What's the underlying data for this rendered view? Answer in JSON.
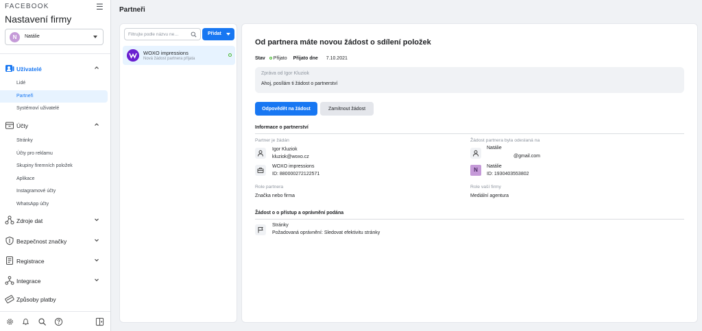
{
  "app": {
    "brand": "FACEBOOK",
    "title": "Nastavení firmy"
  },
  "account": {
    "initial": "N",
    "name": "Natálie"
  },
  "sidebar": {
    "sections": [
      {
        "label": "Uživatelé",
        "icon": "users-icon",
        "expanded": true,
        "items": [
          {
            "label": "Lidé"
          },
          {
            "label": "Partneři",
            "selected": true
          },
          {
            "label": "Systémoví uživatelé"
          }
        ]
      },
      {
        "label": "Účty",
        "icon": "accounts-icon",
        "expanded": true,
        "items": [
          {
            "label": "Stránky"
          },
          {
            "label": "Účty pro reklamu"
          },
          {
            "label": "Skupiny firemních položek"
          },
          {
            "label": "Aplikace"
          },
          {
            "label": "Instagramové účty"
          },
          {
            "label": "WhatsApp účty"
          }
        ]
      },
      {
        "label": "Zdroje dat",
        "icon": "data-sources-icon",
        "expanded": false
      },
      {
        "label": "Bezpečnost značky",
        "icon": "shield-icon",
        "expanded": false
      },
      {
        "label": "Registrace",
        "icon": "registration-icon",
        "expanded": false
      },
      {
        "label": "Integrace",
        "icon": "integrations-icon",
        "expanded": false
      },
      {
        "label": "Způsoby platby",
        "icon": "payment-icon",
        "expanded": false
      }
    ]
  },
  "header": {
    "title": "Partneři"
  },
  "list": {
    "filter_placeholder": "Filtrujte podle názvu ne…",
    "add_label": "Přidat",
    "items": [
      {
        "name": "WOXO impressions",
        "subtitle": "Nová žádost partnera přijata"
      }
    ]
  },
  "detail": {
    "title": "Od partnera máte novou žádost o sdílení položek",
    "status_label": "Stav",
    "status_value": "Přijato",
    "received_label": "Přijato dne",
    "received_value": "7.10.2021",
    "message_label": "Zpráva od Igor Kluziok",
    "message_text": "Ahoj, posílám ti žádost o partnerství",
    "respond_label": "Odpovědět na žádost",
    "decline_label": "Zamítnout žádost",
    "info_heading": "Informace o partnerství",
    "partner_label": "Partner je žádán",
    "partner_person_name": "Igor Kluziok",
    "partner_person_email": "kluziok@woxo.cz",
    "partner_company_name": "WOXO impressions",
    "partner_company_id": "ID: 880000272122571",
    "sent_to_label": "Žádost partnera byla odeslaná na",
    "sent_to_name": "Natálie",
    "sent_to_email": "@gmail.com",
    "sent_to_biz_initial": "N",
    "sent_to_biz_name": "Natálie",
    "sent_to_biz_id": "ID: 1930403553802",
    "role_partner_label": "Role partnera",
    "role_partner_value": "Značka nebo firma",
    "role_you_label": "Role vaší firmy",
    "role_you_value": "Mediální agentura",
    "access_heading": "Žádost o o přístup a oprávnění podána",
    "asset_type": "Stránky",
    "asset_permission": "Požadovaná oprávnění: Sledovat efektivitu stránky"
  },
  "colors": {
    "accent": "#1877f2",
    "selected_bg": "#e7f3ff",
    "status_green": "#42b72a",
    "partner_logo": "#6a1fd0"
  }
}
